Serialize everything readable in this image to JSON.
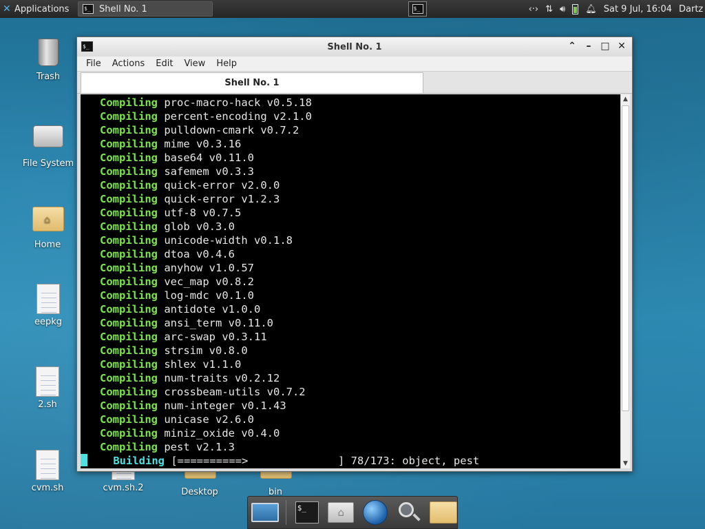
{
  "top_panel": {
    "applications_label": "Applications",
    "task_label": "Shell No. 1",
    "clock": "Sat  9 Jul, 16:04",
    "user": "Dartz"
  },
  "desktop_icons": [
    {
      "label": "Trash",
      "icon": "trash-icon"
    },
    {
      "label": "File System",
      "icon": "drive-icon"
    },
    {
      "label": "Home",
      "icon": "home-folder-icon"
    },
    {
      "label": "eepkg",
      "icon": "document-icon"
    },
    {
      "label": "2.sh",
      "icon": "document-icon"
    },
    {
      "label": "cvm.sh",
      "icon": "document-icon"
    },
    {
      "label": "cvm.sh.2",
      "icon": "document-icon"
    },
    {
      "label": "Desktop",
      "icon": "folder-icon"
    },
    {
      "label": "bin",
      "icon": "folder-icon"
    }
  ],
  "window": {
    "title": "Shell No. 1",
    "menu": [
      "File",
      "Actions",
      "Edit",
      "View",
      "Help"
    ],
    "tab_label": "Shell No. 1"
  },
  "terminal": {
    "lines": [
      {
        "status": "Compiling",
        "text": "proc-macro-hack v0.5.18"
      },
      {
        "status": "Compiling",
        "text": "percent-encoding v2.1.0"
      },
      {
        "status": "Compiling",
        "text": "pulldown-cmark v0.7.2"
      },
      {
        "status": "Compiling",
        "text": "mime v0.3.16"
      },
      {
        "status": "Compiling",
        "text": "base64 v0.11.0"
      },
      {
        "status": "Compiling",
        "text": "safemem v0.3.3"
      },
      {
        "status": "Compiling",
        "text": "quick-error v2.0.0"
      },
      {
        "status": "Compiling",
        "text": "quick-error v1.2.3"
      },
      {
        "status": "Compiling",
        "text": "utf-8 v0.7.5"
      },
      {
        "status": "Compiling",
        "text": "glob v0.3.0"
      },
      {
        "status": "Compiling",
        "text": "unicode-width v0.1.8"
      },
      {
        "status": "Compiling",
        "text": "dtoa v0.4.6"
      },
      {
        "status": "Compiling",
        "text": "anyhow v1.0.57"
      },
      {
        "status": "Compiling",
        "text": "vec_map v0.8.2"
      },
      {
        "status": "Compiling",
        "text": "log-mdc v0.1.0"
      },
      {
        "status": "Compiling",
        "text": "antidote v1.0.0"
      },
      {
        "status": "Compiling",
        "text": "ansi_term v0.11.0"
      },
      {
        "status": "Compiling",
        "text": "arc-swap v0.3.11"
      },
      {
        "status": "Compiling",
        "text": "strsim v0.8.0"
      },
      {
        "status": "Compiling",
        "text": "shlex v1.1.0"
      },
      {
        "status": "Compiling",
        "text": "num-traits v0.2.12"
      },
      {
        "status": "Compiling",
        "text": "crossbeam-utils v0.7.2"
      },
      {
        "status": "Compiling",
        "text": "num-integer v0.1.43"
      },
      {
        "status": "Compiling",
        "text": "unicase v2.6.0"
      },
      {
        "status": "Compiling",
        "text": "miniz_oxide v0.4.0"
      },
      {
        "status": "Compiling",
        "text": "pest v2.1.3"
      }
    ],
    "building_status": "Building",
    "building_text": "[==========>              ] 78/173: object, pest"
  },
  "dock": [
    "show-desktop-icon",
    "terminal-icon",
    "home-icon",
    "web-browser-icon",
    "search-icon",
    "folder-icon"
  ]
}
